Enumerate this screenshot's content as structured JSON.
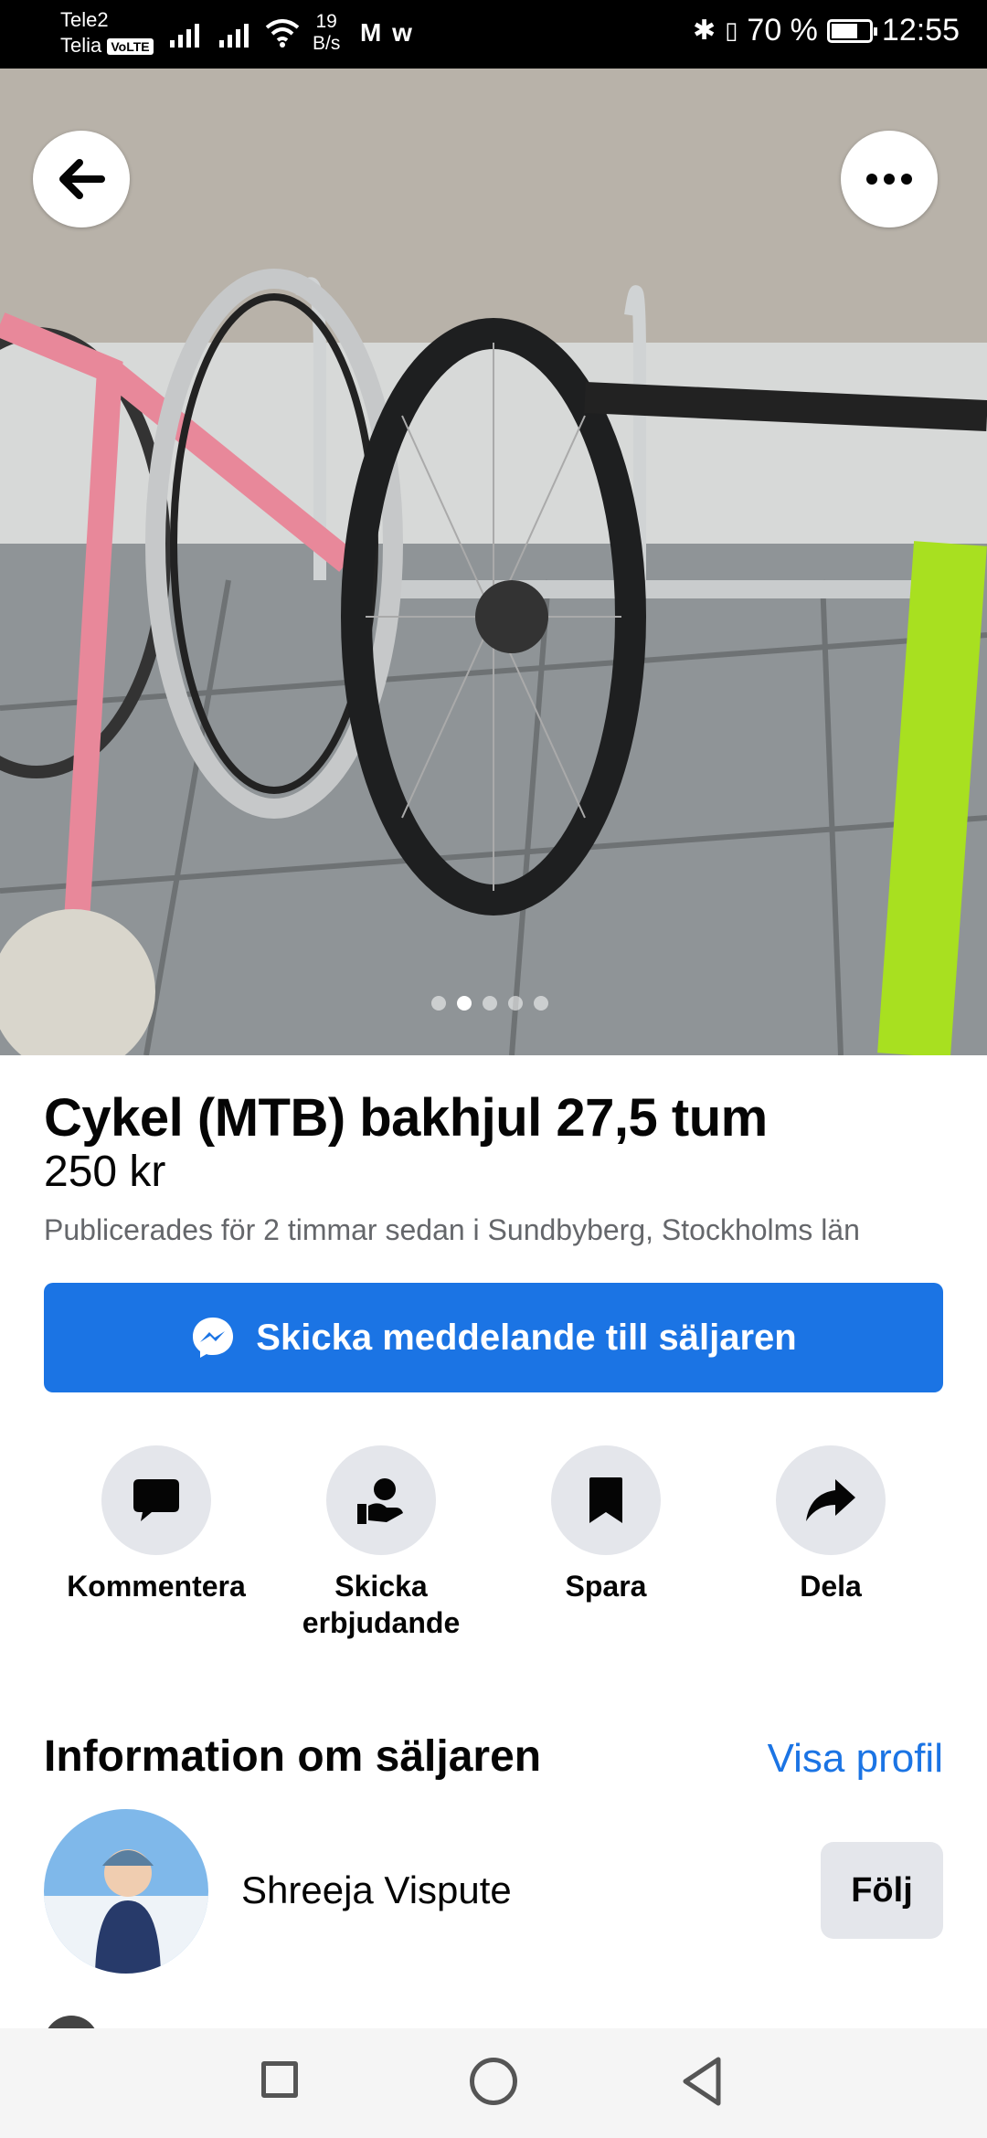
{
  "status_bar": {
    "carrier1": "Tele2",
    "carrier2": "Telia",
    "volte": "VoLTE",
    "speed_value": "19",
    "speed_unit": "B/s",
    "apps": "M w",
    "battery": "70 %",
    "battery_level": 0.7,
    "time": "12:55"
  },
  "photo": {
    "page_count": 5,
    "active_page": 2
  },
  "listing": {
    "title": "Cykel (MTB) bakhjul 27,5 tum",
    "price": "250 kr",
    "posted": "Publicerades för 2 timmar sedan i Sundbyberg, Stockholms län"
  },
  "message_button": {
    "label": "Skicka meddelande till säljaren",
    "color": "#1b74e4"
  },
  "actions": [
    {
      "label": "Kommentera",
      "icon": "comment-icon"
    },
    {
      "label": "Skicka erbjudande",
      "icon": "offer-icon"
    },
    {
      "label": "Spara",
      "icon": "bookmark-icon"
    },
    {
      "label": "Dela",
      "icon": "share-icon"
    }
  ],
  "seller": {
    "heading": "Information om säljaren",
    "profile_link": "Visa profil",
    "name": "Shreeja Vispute",
    "follow_label": "Följ"
  }
}
